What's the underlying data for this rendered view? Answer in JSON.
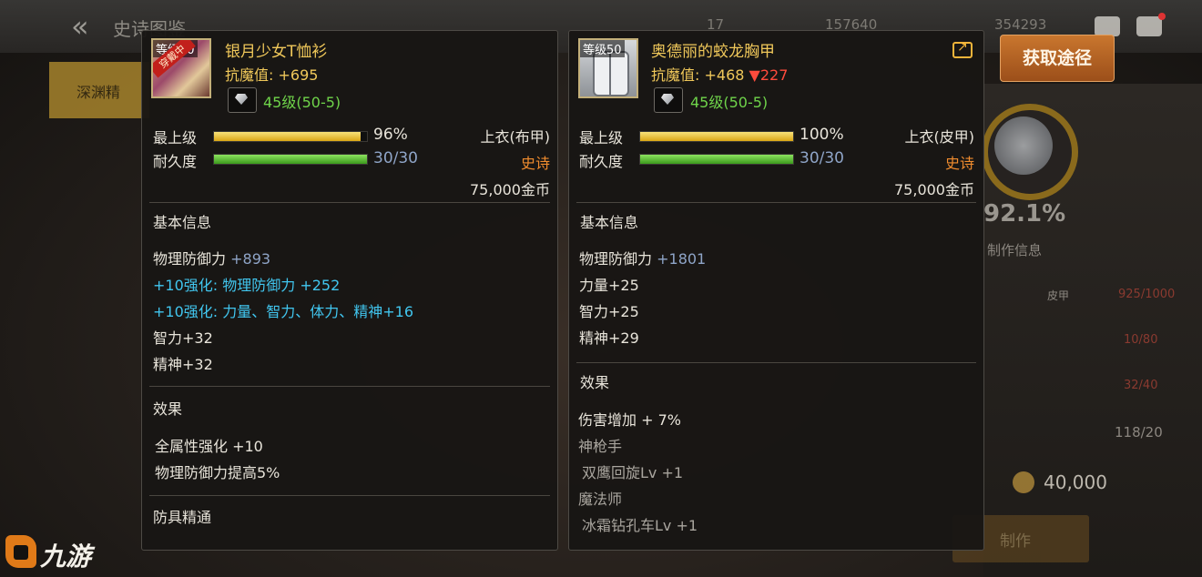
{
  "app": {
    "title": "史诗图鉴",
    "resources": [
      "17",
      "157640",
      "354293"
    ],
    "left_tab": "深渊精",
    "get_button": "获取途径",
    "right_panel": {
      "percent": "92.1%",
      "info_tab": "制作信息",
      "row1_label": "皮甲",
      "row1_value": "925/1000",
      "row2_value": "10/80",
      "row3_value": "32/40",
      "row4_value": "118/20",
      "cost": "40,000",
      "make_button": "制作"
    },
    "logo": "九游"
  },
  "colors": {
    "epic": "#f08c2e",
    "enhance": "#41c6ef",
    "gem": "#6fd44a",
    "down": "#ff4b3c",
    "title": "#f0c85a"
  },
  "item_left": {
    "level_tag": "等级50",
    "wearing_badge": "穿戴中",
    "name": "银月少女T恤衫",
    "resist_label": "抗魔值:",
    "resist_value": "+695",
    "gem_text": "45级(50-5)",
    "max_level_label": "最上级",
    "max_level_percent": 96,
    "max_level_text": "96%",
    "durability_label": "耐久度",
    "durability": 1,
    "durability_text": "30/30",
    "slot": "上衣(布甲)",
    "rarity": "史诗",
    "price": "75,000金币",
    "basic_info_title": "基本信息",
    "phys_def_label": "物理防御力",
    "phys_def_value": "+893",
    "enhance1": "+10强化: 物理防御力 +252",
    "enhance2": "+10强化: 力量、智力、体力、精神+16",
    "stat1": "智力+32",
    "stat2": "精神+32",
    "effect_title": "效果",
    "effect1": "全属性强化 +10",
    "effect2": "物理防御力提高5%",
    "armor_mastery": "防具精通"
  },
  "item_right": {
    "level_tag": "等级50",
    "name": "奥德丽的蛟龙胸甲",
    "resist_label": "抗魔值:",
    "resist_value": "+468",
    "resist_down": "▼227",
    "gem_text": "45级(50-5)",
    "max_level_label": "最上级",
    "max_level_percent": 100,
    "max_level_text": "100%",
    "durability_label": "耐久度",
    "durability": 1,
    "durability_text": "30/30",
    "slot": "上衣(皮甲)",
    "rarity": "史诗",
    "price": "75,000金币",
    "basic_info_title": "基本信息",
    "phys_def_label": "物理防御力",
    "phys_def_value": "+1801",
    "stat1": "力量+25",
    "stat2": "智力+25",
    "stat3": "精神+29",
    "effect_title": "效果",
    "effect1": "伤害增加 + 7%",
    "class1": "神枪手",
    "skill1": "双鹰回旋Lv +1",
    "class2": "魔法师",
    "skill2": "冰霜钻孔车Lv +1"
  }
}
